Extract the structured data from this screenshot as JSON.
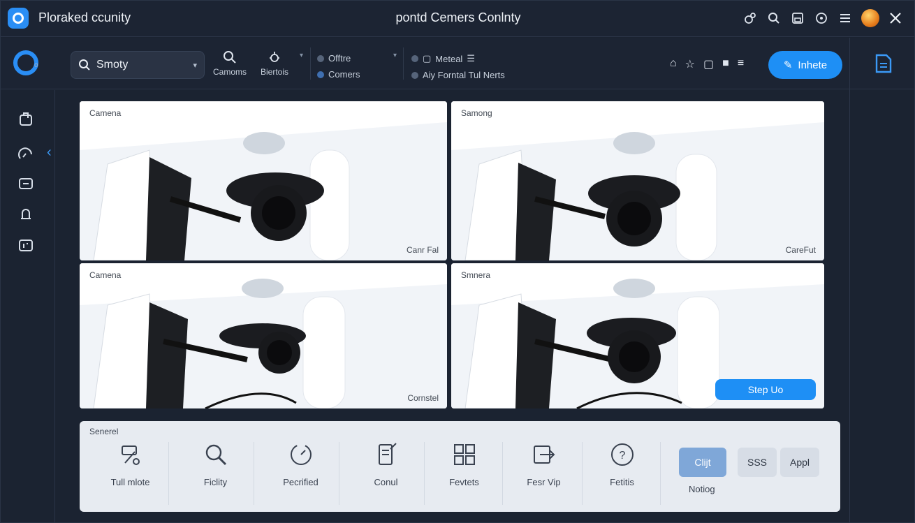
{
  "titlebar": {
    "app_title": "Ploraked ccunity",
    "window_title": "pontd Cemers Conlnty",
    "icons": [
      "link-icon",
      "search-icon",
      "save-icon",
      "help-icon",
      "menu-icon",
      "avatar",
      "close-icon"
    ]
  },
  "toolbar": {
    "search": {
      "value": "Smoty"
    },
    "buttons": [
      {
        "label": "Camoms",
        "icon": "search-icon"
      },
      {
        "label": "Biertois",
        "icon": "bug-icon"
      }
    ],
    "group1": [
      "Offtre",
      "Comers"
    ],
    "group2": [
      "Meteal",
      "Aiy Forntal  Tul Nerts"
    ],
    "small_icons": [
      "home-icon",
      "star-icon",
      "square-icon",
      "folder-icon",
      "list-icon"
    ],
    "primary_button": "Inhete"
  },
  "cameras": [
    {
      "label": "Camena",
      "caption": "Canr Fal"
    },
    {
      "label": "Samong",
      "caption": "CareFut"
    },
    {
      "label": "Camena",
      "caption": "Cornstel"
    },
    {
      "label": "Smnera",
      "caption": ""
    }
  ],
  "stop_button": "Step Uo",
  "bottom_panel": {
    "title": "Senerel",
    "tools": [
      {
        "label": "Tull mlote",
        "icon": "tools-icon"
      },
      {
        "label": "Ficlity",
        "icon": "search-icon"
      },
      {
        "label": "Pecrified",
        "icon": "timer-icon"
      },
      {
        "label": "Conul",
        "icon": "document-edit-icon"
      },
      {
        "label": "Fevtets",
        "icon": "grid-icon"
      },
      {
        "label": "Fesr Vip",
        "icon": "export-icon"
      },
      {
        "label": "Fetitis",
        "icon": "help-circle-icon"
      }
    ],
    "pills": [
      "Clijt",
      "SSS",
      "Appl"
    ],
    "pill_caption": "Notiog"
  }
}
